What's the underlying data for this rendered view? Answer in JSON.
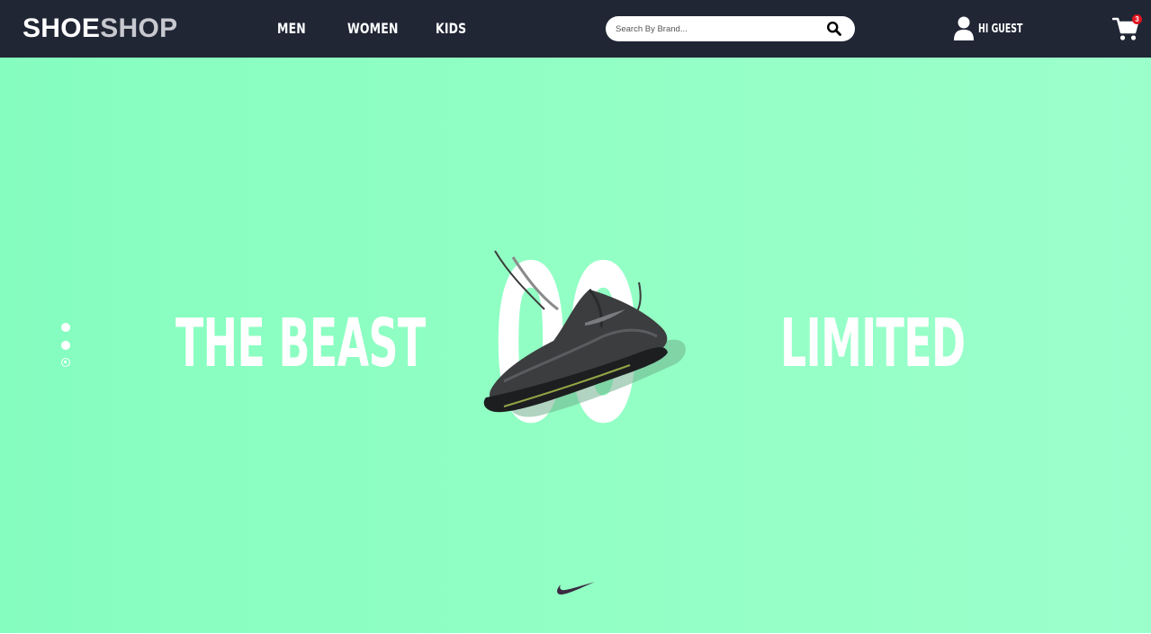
{
  "brand": {
    "part1": "SHOE",
    "part2": "SHOP"
  },
  "nav": {
    "links": [
      "MEN",
      "WOMEN",
      "KIDS"
    ]
  },
  "search": {
    "placeholder": "Search By Brand...",
    "icon": "search-icon"
  },
  "user": {
    "label": "HI GUEST",
    "icon": "user-icon"
  },
  "cart": {
    "icon": "cart-icon",
    "count": "3"
  },
  "hero": {
    "left_text": "THE BEAST",
    "center_text": "00",
    "right_text": "LIMITED",
    "slides": {
      "count": 3,
      "active_index": 2
    },
    "brand_mark": "nike-swoosh-icon"
  },
  "colors": {
    "navbar": "#212635",
    "hero_bg": "#92ffc4",
    "cart_badge": "#e0141e",
    "logo_secondary": "#c7c9cf"
  }
}
